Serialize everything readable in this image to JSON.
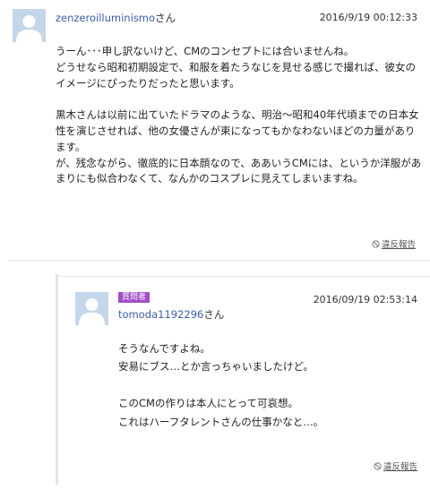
{
  "answer": {
    "username": "zenzeroilluminismo",
    "username_suffix": "さん",
    "timestamp": "2016/9/19  00:12:33",
    "paragraphs": [
      "うーん･･･申し訳ないけど、CMのコンセプトには合いませんね。",
      "どうせなら昭和初期設定で、和服を着たうなじを見せる感じで撮れば、彼女のイメージにぴったりだったと思います。",
      "",
      "黒木さんは以前に出ていたドラマのような、明治～昭和40年代頃までの日本女性を演じさせれば、他の女優さんが束になってもかなわないほどの力量があります。",
      "が、残念ながら、徹底的に日本顔なので、ああいうCMには、というか洋服があまりにも似合わなくて、なんかのコスプレに見えてしまいますね。"
    ],
    "report_label": "違反報告"
  },
  "reply": {
    "badge": "質問者",
    "username": "tomoda1192296",
    "username_suffix": "さん",
    "timestamp": "2016/09/19  02:53:14",
    "paragraphs": [
      "そうなんですよね。",
      "安易にブス…とか言っちゃいましたけど。",
      "",
      "このCMの作りは本人にとって可哀想。",
      "これはハーフタレントさんの仕事かなと…。"
    ],
    "report_label": "違反報告"
  },
  "colors": {
    "username_link": "#3a5fa8",
    "badge_bg": "#a04ec8",
    "avatar_bg": "#c4d6ea"
  }
}
